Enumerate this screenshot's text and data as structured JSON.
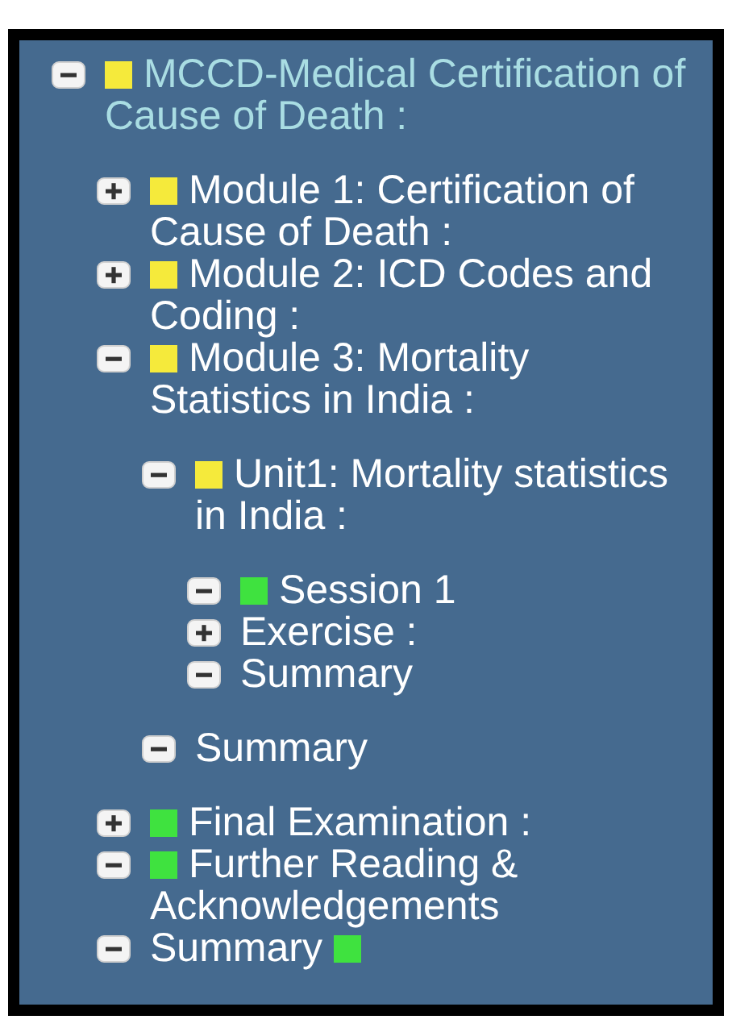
{
  "tree": [
    {
      "label": "MCCD-Medical Certification of Cause of Death :",
      "expanded": true,
      "selected": true,
      "kind": "lead-square",
      "color": "#f5ea3b",
      "children": [
        {
          "label": "Module 1: Certification of Cause of Death :",
          "expanded": false,
          "selected": false,
          "kind": "lead-square",
          "color": "#f5ea3b"
        },
        {
          "label": "Module 2: ICD Codes and Coding :",
          "expanded": false,
          "selected": false,
          "kind": "lead-square",
          "color": "#f5ea3b"
        },
        {
          "label": "Module 3: Mortality Statistics in India :",
          "expanded": true,
          "selected": false,
          "kind": "lead-square",
          "color": "#f5ea3b",
          "children": [
            {
              "label": "Unit1: Mortality statistics in India :",
              "expanded": true,
              "selected": false,
              "kind": "lead-square",
              "color": "#f5ea3b",
              "children": [
                {
                  "label": "Session 1",
                  "expanded": true,
                  "selected": false,
                  "kind": "lead-square",
                  "color": "#3fe23f"
                },
                {
                  "label": "Exercise :",
                  "expanded": false,
                  "selected": false,
                  "kind": "plain"
                },
                {
                  "label": "Summary",
                  "expanded": true,
                  "selected": false,
                  "kind": "plain"
                }
              ]
            },
            {
              "label": "Summary",
              "expanded": true,
              "selected": false,
              "kind": "plain"
            }
          ]
        },
        {
          "label": "Final Examination :",
          "expanded": false,
          "selected": false,
          "kind": "lead-square",
          "color": "#3fe23f"
        },
        {
          "label": "Further Reading & Acknowledgements",
          "expanded": true,
          "selected": false,
          "kind": "lead-square",
          "color": "#3fe23f"
        },
        {
          "label": "Summary",
          "expanded": true,
          "selected": false,
          "kind": "trail-square",
          "color": "#3fe23f"
        }
      ]
    }
  ]
}
